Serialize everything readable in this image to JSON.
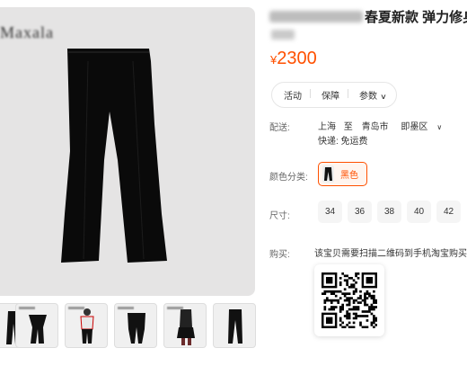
{
  "product": {
    "title": "春夏新款 弹力修身",
    "price_symbol": "¥",
    "price": "2300"
  },
  "tabs": [
    {
      "label": "活动"
    },
    {
      "label": "保障"
    },
    {
      "label": "参数"
    }
  ],
  "shipping": {
    "label": "配送:",
    "from": "上海",
    "to_word": "至",
    "city": "青岛市",
    "district": "即墨区",
    "express": "快递: 免运费"
  },
  "color": {
    "label": "颜色分类:",
    "selected": "黑色"
  },
  "size": {
    "label": "尺寸:",
    "options": [
      "34",
      "36",
      "38",
      "40",
      "42"
    ]
  },
  "purchase": {
    "label": "购买:",
    "note": "该宝贝需要扫描二维码到手机淘宝购买"
  },
  "colors": {
    "accent": "#ff5000",
    "accent_bg": "#fff5ef",
    "image_bg": "#e5e4e4",
    "size_bg": "#f5f5f5"
  },
  "icons": [
    "chevron-down-icon",
    "qr-code-icon",
    "pants-icon"
  ]
}
